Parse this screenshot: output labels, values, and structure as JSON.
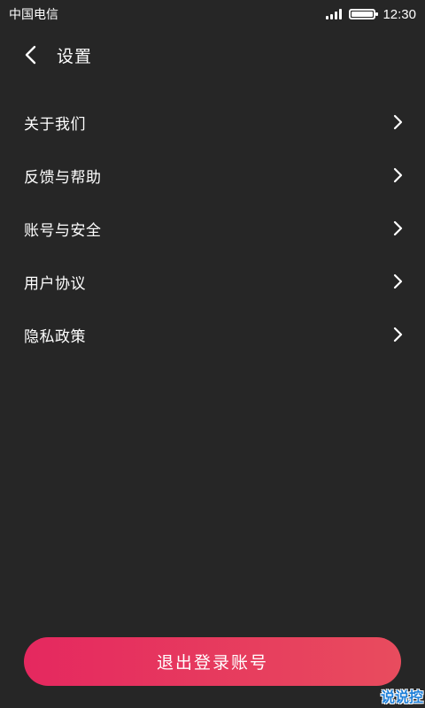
{
  "status_bar": {
    "carrier": "中国电信",
    "time": "12:30",
    "battery_level": 1.0
  },
  "header": {
    "back_icon": "chevron-left-icon",
    "title": "设置"
  },
  "menu": {
    "items": [
      {
        "label": "关于我们",
        "icon": "chevron-right-icon"
      },
      {
        "label": "反馈与帮助",
        "icon": "chevron-right-icon"
      },
      {
        "label": "账号与安全",
        "icon": "chevron-right-icon"
      },
      {
        "label": "用户协议",
        "icon": "chevron-right-icon"
      },
      {
        "label": "隐私政策",
        "icon": "chevron-right-icon"
      }
    ]
  },
  "logout": {
    "label": "退出登录账号"
  },
  "watermark": {
    "text": "说说控"
  },
  "colors": {
    "background": "#262626",
    "accent_start": "#e5285f",
    "accent_end": "#e84c5e",
    "text": "#ffffff"
  }
}
